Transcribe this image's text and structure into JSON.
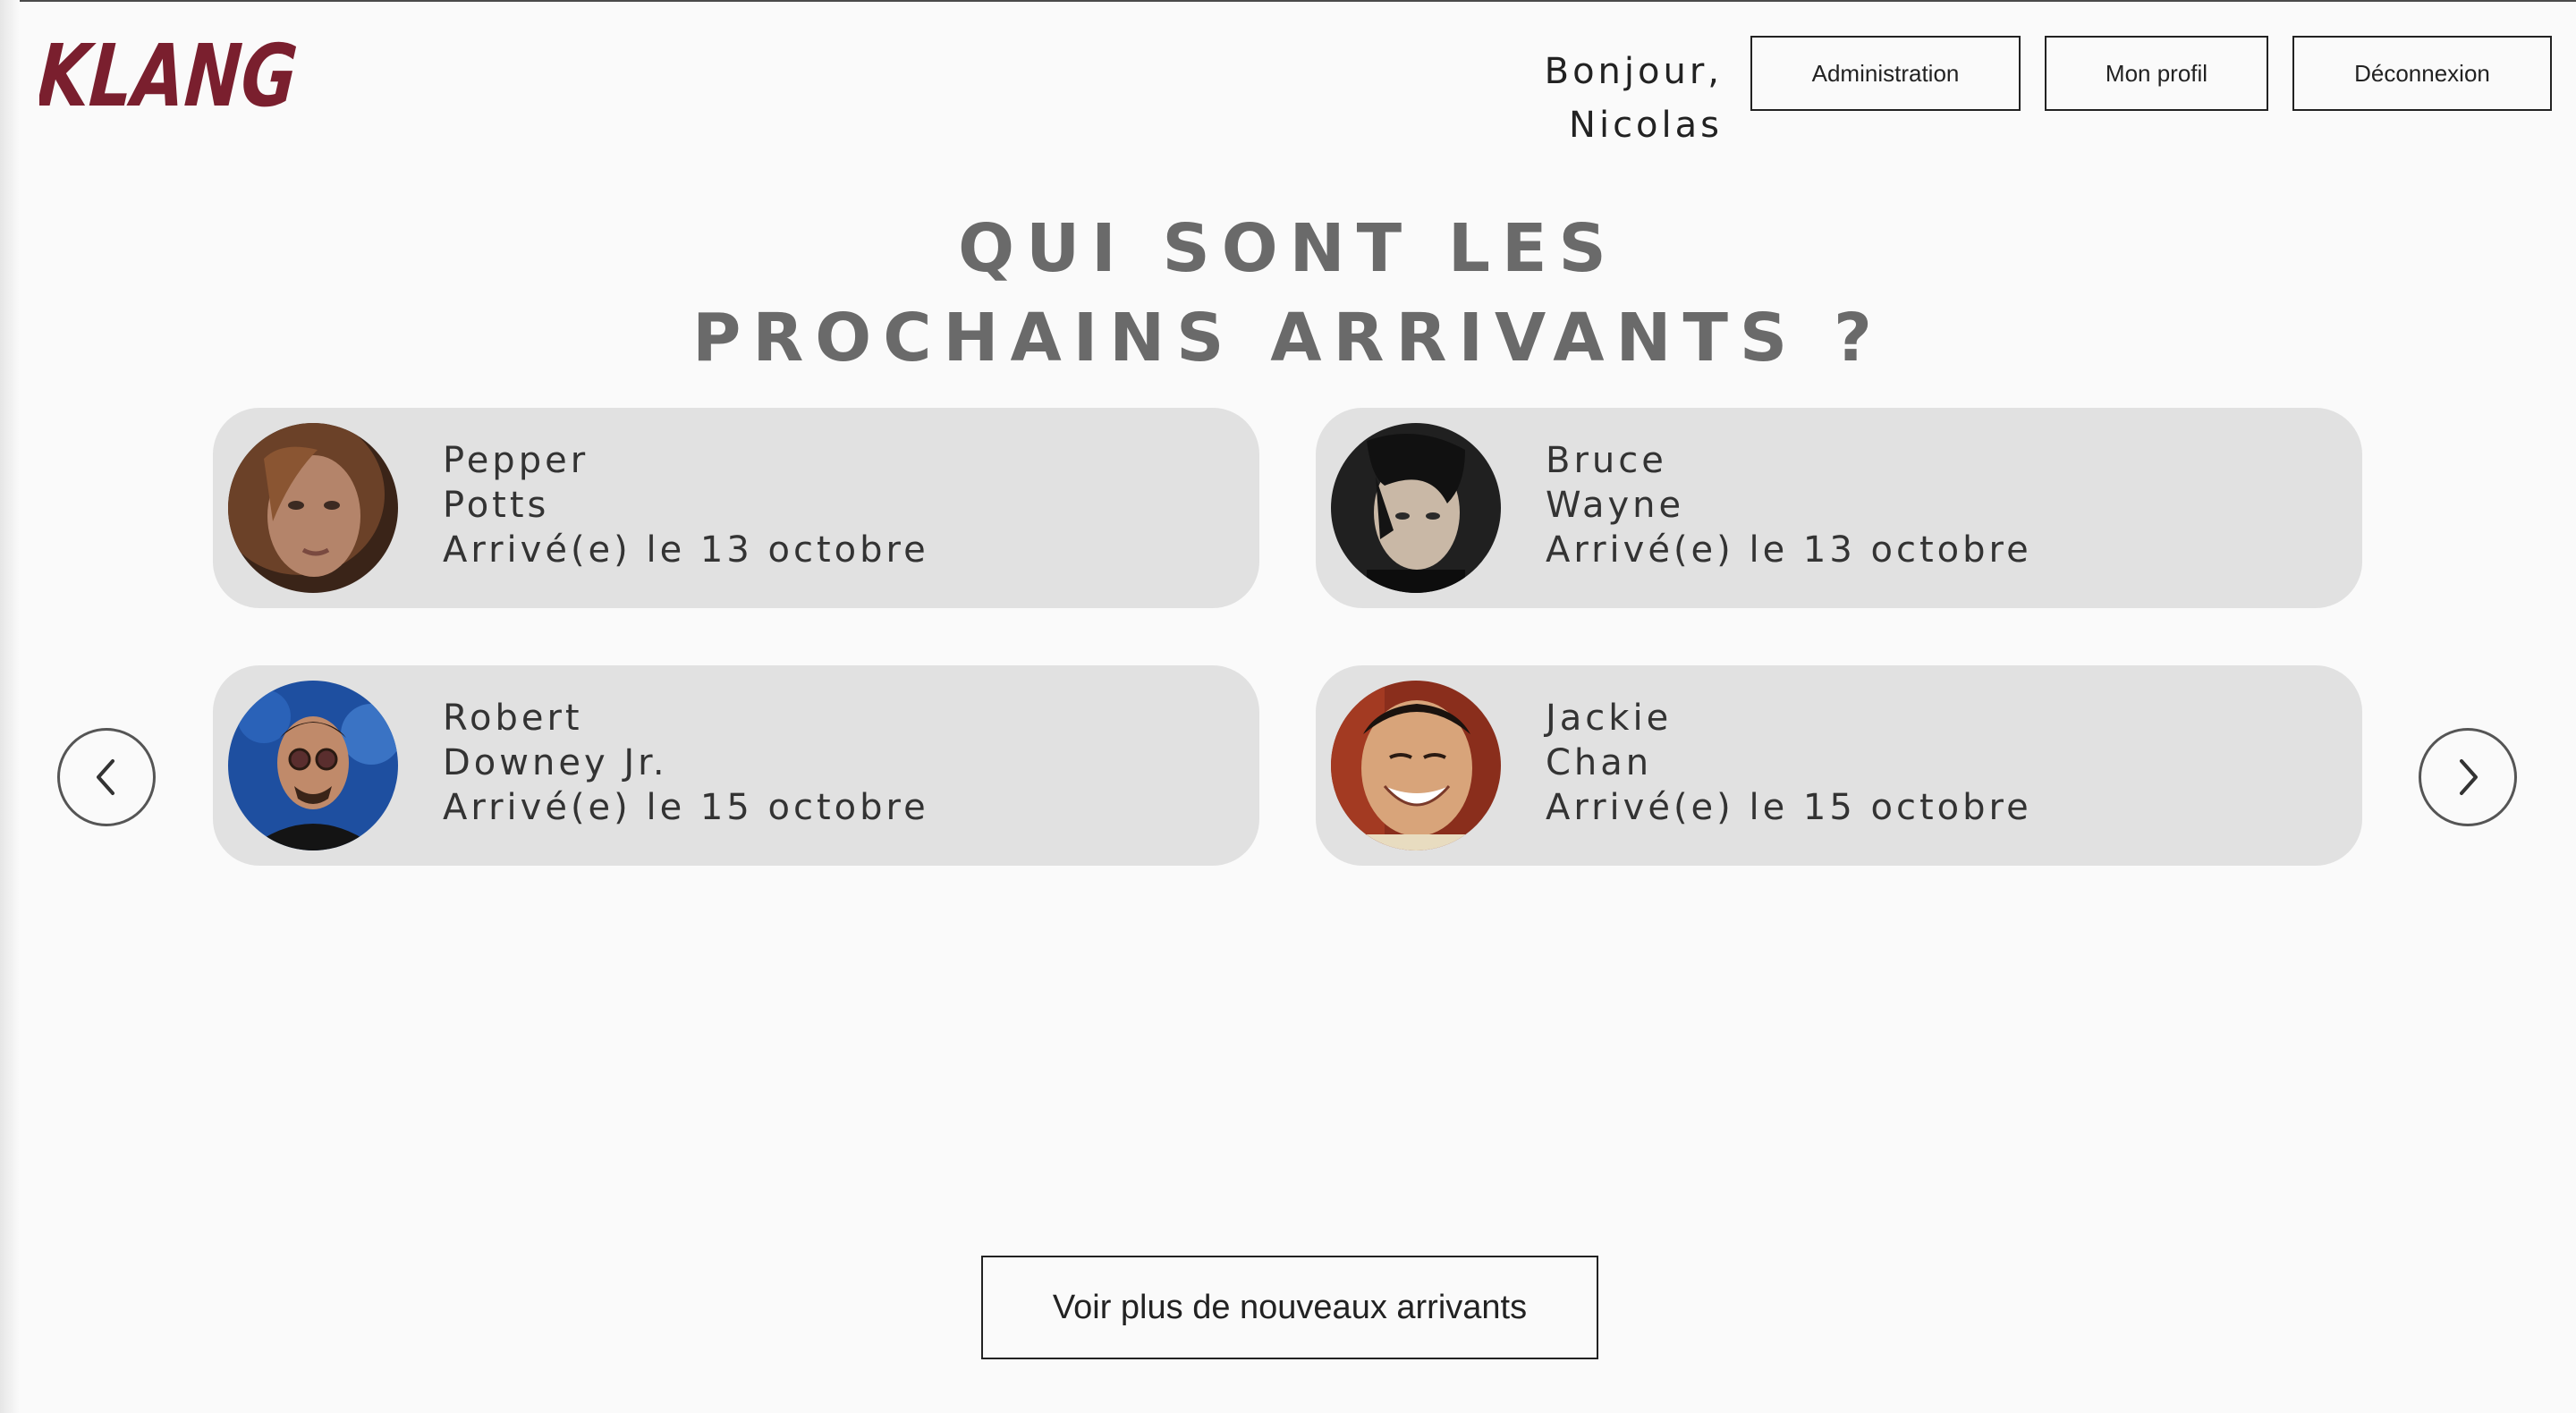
{
  "brand": {
    "logo_text": "KLANG",
    "logo_color": "#7a1f2e"
  },
  "header": {
    "greeting": "Bonjour, Nicolas",
    "buttons": {
      "admin": "Administration",
      "profile": "Mon profil",
      "logout": "Déconnexion"
    }
  },
  "main": {
    "title_line1": "QUI SONT LES",
    "title_line2": "PROCHAINS ARRIVANTS ?",
    "arrivals": [
      {
        "first_name": "Pepper",
        "last_name": "Potts",
        "arrival": "Arrivé(e) le 13 octobre"
      },
      {
        "first_name": "Bruce",
        "last_name": "Wayne",
        "arrival": "Arrivé(e) le 13 octobre"
      },
      {
        "first_name": "Robert",
        "last_name": "Downey Jr.",
        "arrival": "Arrivé(e) le 15 octobre"
      },
      {
        "first_name": "Jackie",
        "last_name": "Chan",
        "arrival": "Arrivé(e) le 15 octobre"
      }
    ],
    "nav": {
      "prev_icon": "chevron-left-icon",
      "next_icon": "chevron-right-icon"
    },
    "more_button": "Voir plus de nouveaux arrivants"
  },
  "colors": {
    "background": "#fafafa",
    "card": "#e1e1e1",
    "title": "#6a6a6a",
    "logo": "#7a1f2e"
  }
}
